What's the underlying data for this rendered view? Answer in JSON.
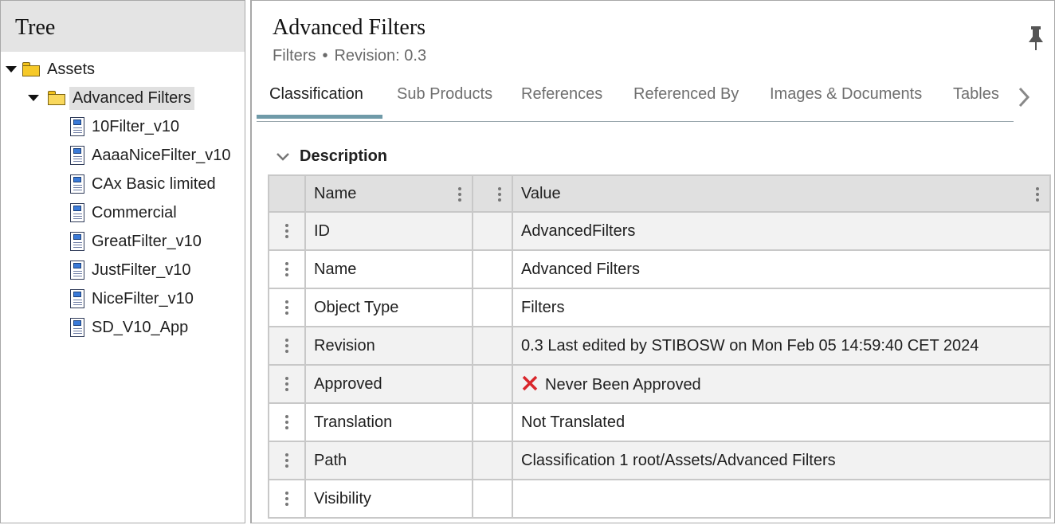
{
  "tree": {
    "title": "Tree",
    "root": {
      "label": "Assets"
    },
    "folder": {
      "label": "Advanced Filters"
    },
    "items": [
      "10Filter_v10",
      "AaaaNiceFilter_v10",
      "CAx Basic limited",
      "Commercial",
      "GreatFilter_v10",
      "JustFilter_v10",
      "NiceFilter_v10",
      "SD_V10_App"
    ]
  },
  "header": {
    "title": "Advanced Filters",
    "object_type": "Filters",
    "separator": "•",
    "revision": "Revision: 0.3"
  },
  "tabs": [
    {
      "label": "Classification",
      "active": true
    },
    {
      "label": "Sub Products",
      "active": false
    },
    {
      "label": "References",
      "active": false
    },
    {
      "label": "Referenced By",
      "active": false
    },
    {
      "label": "Images & Documents",
      "active": false
    },
    {
      "label": "Tables",
      "active": false
    }
  ],
  "section": {
    "title": "Description"
  },
  "table": {
    "columns": {
      "name": "Name",
      "value": "Value"
    },
    "rows": [
      {
        "name": "ID",
        "value": "AdvancedFilters"
      },
      {
        "name": "Name",
        "value": "Advanced Filters"
      },
      {
        "name": "Object Type",
        "value": "Filters"
      },
      {
        "name": "Revision",
        "value": "0.3 Last edited by STIBOSW on Mon Feb 05 14:59:40 CET 2024"
      },
      {
        "name": "Approved",
        "value": "Never Been Approved",
        "status_icon": "red-x-icon"
      },
      {
        "name": "Translation",
        "value": "Not Translated"
      },
      {
        "name": "Path",
        "value": "Classification 1 root/Assets/Advanced Filters"
      },
      {
        "name": "Visibility",
        "value": ""
      }
    ]
  },
  "colors": {
    "accent_underline": "#6f9aa8",
    "folder": "#f6c928",
    "error_red": "#d9262b",
    "header_bg": "#e4e4e4"
  }
}
